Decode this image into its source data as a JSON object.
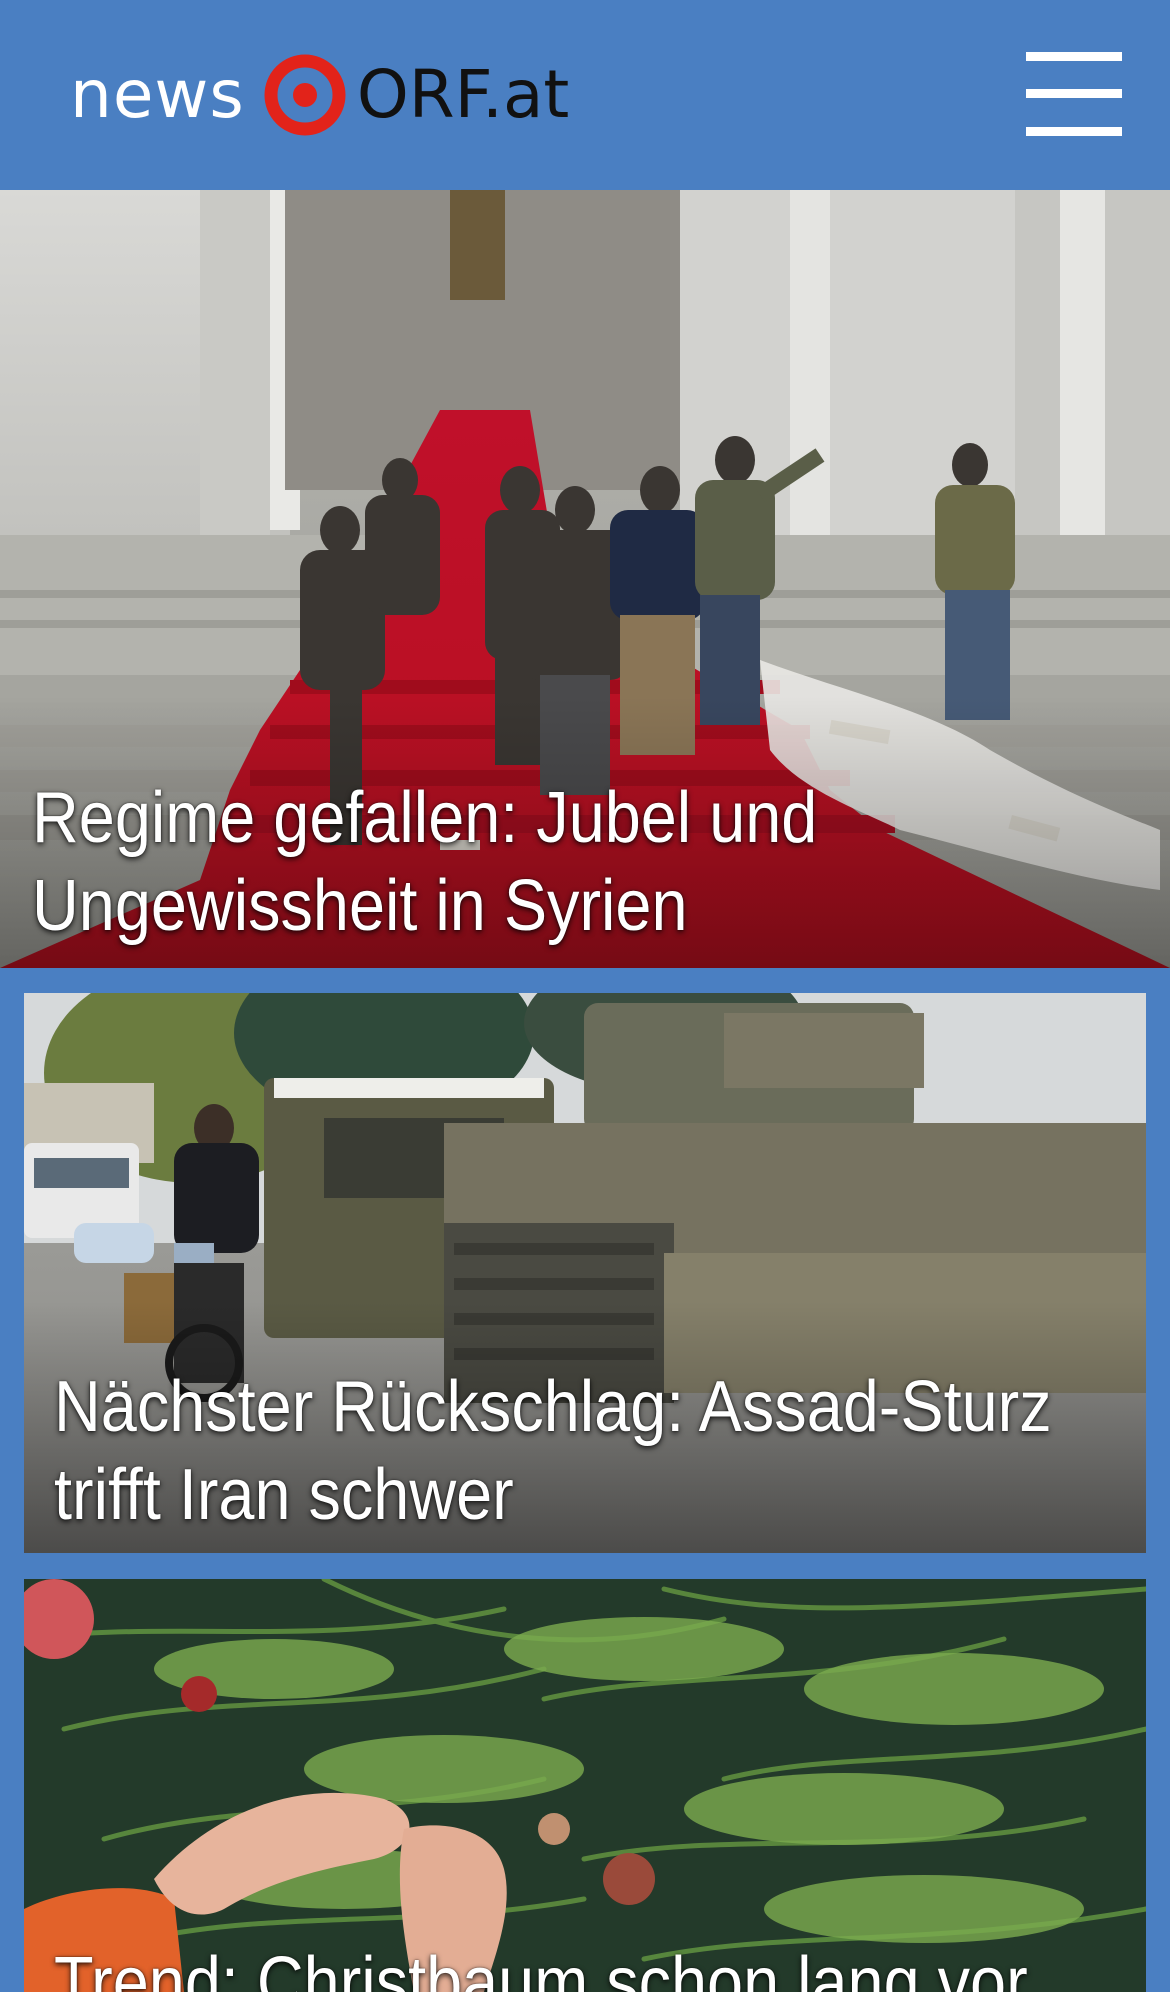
{
  "header": {
    "logo_news": "news",
    "logo_brand": "ORF.at",
    "menu_icon": "hamburger-menu-icon",
    "brand_color": "#4a7fc2",
    "logo_red": "#e2231a"
  },
  "stories": [
    {
      "headline_line1": "Regime gefallen: Jubel und",
      "headline_line2": "Ungewissheit in Syrien",
      "image": "photo-red-carpet-stairs-armed-men"
    },
    {
      "headline_line1": "Nächster Rückschlag: Assad-Sturz",
      "headline_line2": "trifft Iran schwer",
      "image": "photo-tank-and-motorcycle-on-street"
    },
    {
      "headline_line1": "Trend: Christbaum schon lang vor",
      "image": "photo-hands-decorating-christmas-tree"
    }
  ]
}
